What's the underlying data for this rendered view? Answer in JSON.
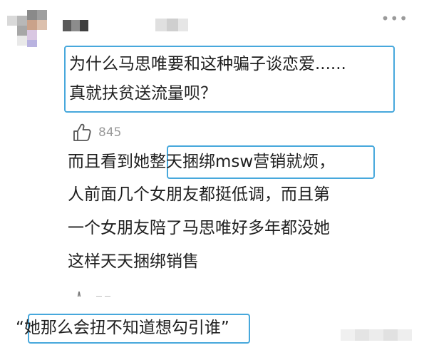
{
  "comment": {
    "line1": "为什么马思唯要和这种骗子谈恋爱......",
    "line2": "真就扶贫送流量呗？",
    "like_icon": "thumbs-up-icon",
    "like_count": "845"
  },
  "reply": {
    "line1_pre": "而且看到她",
    "line1_highlight": "整天捆绑msw营销就烦",
    "line1_post": "，",
    "line2": "人前面几个女朋友都挺低调，而且第",
    "line3": "一个女朋友陪了马思唯好多年都没她",
    "line4": "这样天天捆绑销售"
  },
  "quote": {
    "open": "“",
    "text": "她那么会扭不知道想勾引谁",
    "close": "”"
  },
  "header": {
    "more_icon": "more-dots-icon",
    "more_glyph": "•••"
  },
  "colors": {
    "highlight_border": "#47a8dc",
    "text": "#1f1f1f",
    "muted": "#9a9a9a"
  }
}
